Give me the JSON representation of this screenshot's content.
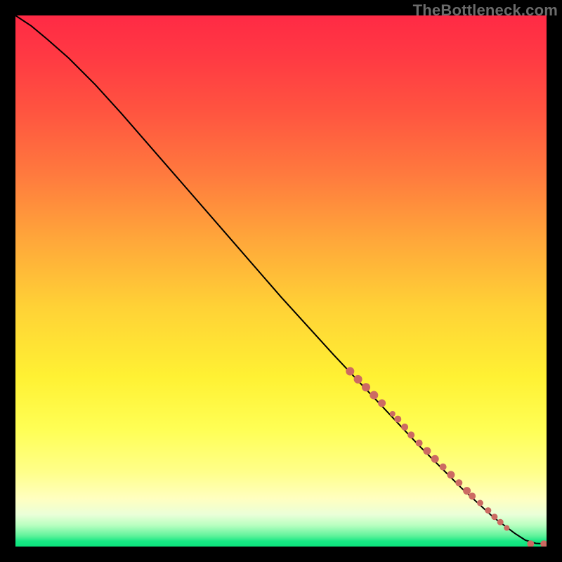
{
  "watermark": "TheBottleneck.com",
  "colors": {
    "background": "#000000",
    "curve": "#000000",
    "marker": "#cc6a62"
  },
  "chart_data": {
    "type": "line",
    "title": "",
    "xlabel": "",
    "ylabel": "",
    "xlim": [
      0,
      100
    ],
    "ylim": [
      0,
      100
    ],
    "series": [
      {
        "name": "bottleneck-curve",
        "x": [
          0,
          3,
          6,
          10,
          15,
          20,
          30,
          40,
          50,
          60,
          68,
          76,
          84,
          90,
          94,
          96,
          98,
          100
        ],
        "y": [
          100,
          98,
          95.5,
          92,
          87,
          81.5,
          70,
          58.5,
          47,
          36,
          27.5,
          19,
          11,
          5.5,
          2.5,
          1.2,
          0.6,
          0.5
        ]
      }
    ],
    "markers": [
      {
        "x": 63,
        "y": 33,
        "r": 6
      },
      {
        "x": 64.5,
        "y": 31.5,
        "r": 6
      },
      {
        "x": 66,
        "y": 30,
        "r": 6
      },
      {
        "x": 67.5,
        "y": 28.5,
        "r": 6
      },
      {
        "x": 69,
        "y": 27,
        "r": 5.5
      },
      {
        "x": 71,
        "y": 25,
        "r": 4
      },
      {
        "x": 72,
        "y": 24,
        "r": 5
      },
      {
        "x": 73.3,
        "y": 22.5,
        "r": 5
      },
      {
        "x": 74.5,
        "y": 21,
        "r": 5
      },
      {
        "x": 76,
        "y": 19.5,
        "r": 5
      },
      {
        "x": 77.5,
        "y": 18,
        "r": 5.5
      },
      {
        "x": 79,
        "y": 16.5,
        "r": 5.5
      },
      {
        "x": 80.5,
        "y": 15,
        "r": 5
      },
      {
        "x": 82,
        "y": 13.5,
        "r": 5.5
      },
      {
        "x": 83.5,
        "y": 12,
        "r": 5
      },
      {
        "x": 85,
        "y": 10.5,
        "r": 5.5
      },
      {
        "x": 86,
        "y": 9.5,
        "r": 5
      },
      {
        "x": 87.5,
        "y": 8.2,
        "r": 4.5
      },
      {
        "x": 89,
        "y": 6.8,
        "r": 4.5
      },
      {
        "x": 90.2,
        "y": 5.6,
        "r": 4.5
      },
      {
        "x": 91.3,
        "y": 4.6,
        "r": 4.5
      },
      {
        "x": 92.5,
        "y": 3.5,
        "r": 4
      },
      {
        "x": 97,
        "y": 0.5,
        "r": 5
      },
      {
        "x": 99.5,
        "y": 0.5,
        "r": 5
      },
      {
        "x": 100.5,
        "y": 0.5,
        "r": 5
      }
    ]
  }
}
